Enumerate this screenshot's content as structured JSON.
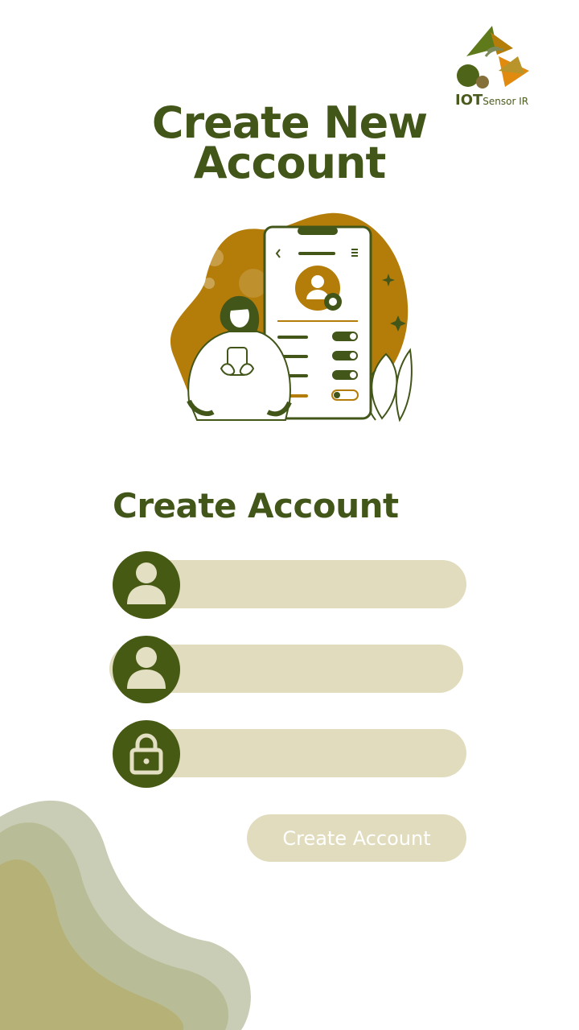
{
  "logo": {
    "brand": "IOT",
    "sub": "Sensor IR"
  },
  "headline": {
    "line1": "Create New",
    "line2": "Account"
  },
  "form": {
    "title": "Create Account",
    "fields": [
      {
        "placeholder": "",
        "value": "",
        "icon": "user-icon"
      },
      {
        "placeholder": "",
        "value": "",
        "icon": "user-icon"
      },
      {
        "placeholder": "",
        "value": "",
        "icon": "lock-icon"
      }
    ],
    "submit_label": "Create Account"
  },
  "colors": {
    "primary": "#43561a",
    "field_bg": "#e0dcbd",
    "accent": "#b47d0a",
    "background": "#ffffff"
  }
}
